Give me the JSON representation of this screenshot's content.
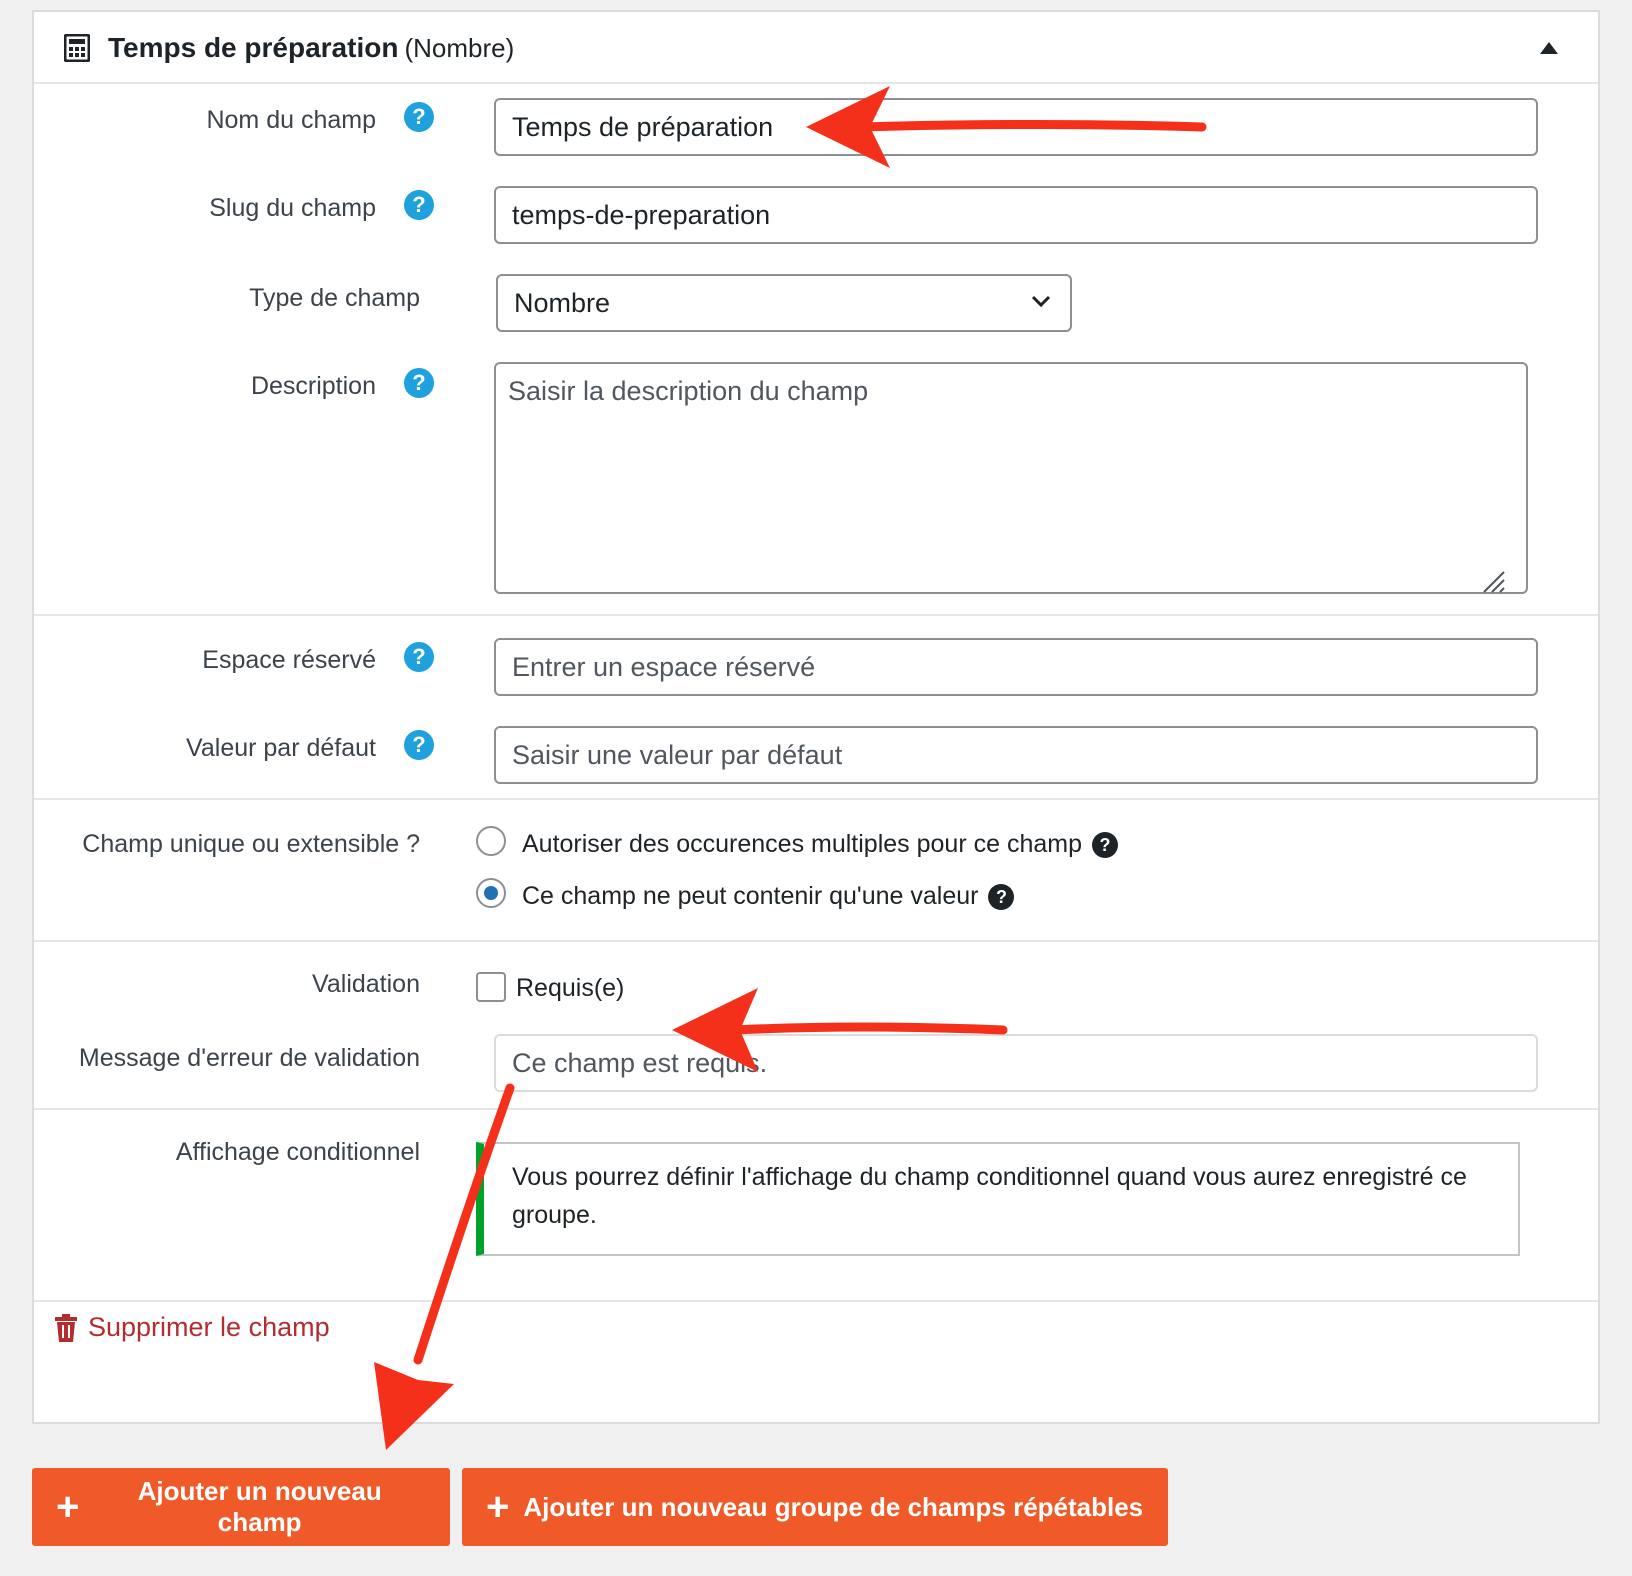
{
  "header": {
    "title": "Temps de préparation",
    "type": "(Nombre)"
  },
  "fields": {
    "name": {
      "label": "Nom du champ",
      "value": "Temps de préparation"
    },
    "slug": {
      "label": "Slug du champ",
      "value": "temps-de-preparation"
    },
    "type": {
      "label": "Type de champ",
      "selected": "Nombre"
    },
    "description": {
      "label": "Description",
      "placeholder": "Saisir la description du champ"
    },
    "placeholder": {
      "label": "Espace réservé",
      "placeholder": "Entrer un espace réservé"
    },
    "default": {
      "label": "Valeur par défaut",
      "placeholder": "Saisir une valeur par défaut"
    },
    "unique": {
      "label": "Champ unique ou extensible ?",
      "option_multiple": "Autoriser des occurences multiples pour ce champ",
      "option_single": "Ce champ ne peut contenir qu'une valeur",
      "selected": "single"
    },
    "validation": {
      "label": "Validation",
      "checkbox_label": "Requis(e)",
      "checked": false
    },
    "error_message": {
      "label": "Message d'erreur de validation",
      "placeholder": "Ce champ est requis."
    },
    "conditional": {
      "label": "Affichage conditionnel",
      "notice": "Vous pourrez définir l'affichage du champ conditionnel quand vous aurez enregistré ce groupe."
    }
  },
  "actions": {
    "delete": "Supprimer le champ",
    "add_field": "Ajouter un nouveau champ",
    "add_group": "Ajouter un nouveau groupe de champs répétables"
  },
  "help_symbol": "?",
  "colors": {
    "accent_orange": "#f05a28",
    "help_blue": "#1ea1dd",
    "notice_green": "#00a32a",
    "delete_red": "#b32d2e",
    "annotation_arrow": "#f5301a"
  }
}
